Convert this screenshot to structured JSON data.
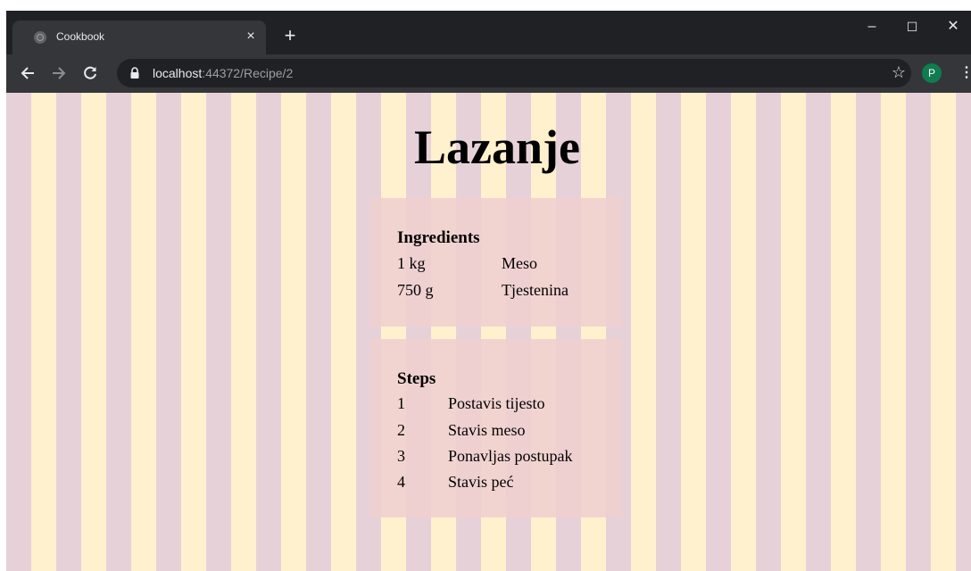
{
  "browser": {
    "tab_title": "Cookbook",
    "tab_close": "×",
    "new_tab": "+",
    "window_minimize": "–",
    "window_maximize": "☐",
    "window_close": "✕",
    "url_host": "localhost",
    "url_rest": ":44372/Recipe/2",
    "profile_initial": "P",
    "icons": {
      "back": "back-arrow-icon",
      "forward": "forward-arrow-icon",
      "reload": "reload-icon",
      "lock": "lock-icon",
      "star": "star-icon",
      "menu": "kebab-menu-icon"
    },
    "colors": {
      "profile_bg": "#0f7d4f"
    }
  },
  "page": {
    "title": "Lazanje",
    "ingredients": {
      "heading": "Ingredients",
      "items": [
        {
          "amount": "1 kg",
          "name": "Meso"
        },
        {
          "amount": "750 g",
          "name": "Tjestenina"
        }
      ]
    },
    "steps": {
      "heading": "Steps",
      "items": [
        {
          "number": "1",
          "text": "Postavis tijesto"
        },
        {
          "number": "2",
          "text": "Stavis meso"
        },
        {
          "number": "3",
          "text": "Ponavljas postupak"
        },
        {
          "number": "4",
          "text": "Stavis peć"
        }
      ]
    },
    "colors": {
      "stripe_a": "#e7d1d9",
      "stripe_b": "#fff1ce",
      "card": "#efcfcf"
    }
  }
}
